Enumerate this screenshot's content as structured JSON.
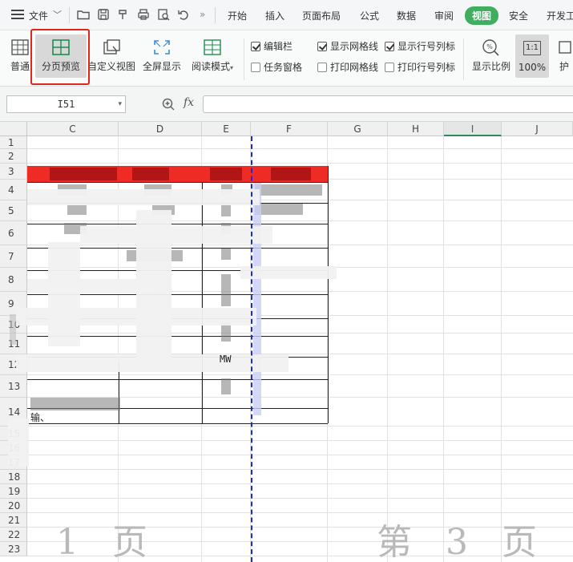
{
  "menubar": {
    "file_label": "文件",
    "tabs": [
      {
        "label": "开始"
      },
      {
        "label": "插入"
      },
      {
        "label": "页面布局"
      },
      {
        "label": "公式"
      },
      {
        "label": "数据"
      },
      {
        "label": "审阅"
      },
      {
        "label": "视图"
      },
      {
        "label": "安全"
      },
      {
        "label": "开发工"
      }
    ],
    "active_tab": "视图",
    "more": "»"
  },
  "ribbon": {
    "buttons": {
      "normal": "普通",
      "page_break_preview": "分页预览",
      "custom_view": "自定义视图",
      "fullscreen": "全屏显示",
      "reading_mode": "阅读模式",
      "zoom": "显示比例",
      "zoom_100": "100%",
      "zoom_100_icon": "1:1",
      "protect": "护"
    },
    "checkboxes": {
      "formula_bar": {
        "label": "编辑栏",
        "checked": true
      },
      "task_pane": {
        "label": "任务窗格",
        "checked": false
      },
      "show_gridlines": {
        "label": "显示网格线",
        "checked": true
      },
      "print_gridlines": {
        "label": "打印网格线",
        "checked": false
      },
      "show_headers": {
        "label": "显示行号列标",
        "checked": true
      },
      "print_headers": {
        "label": "打印行号列标",
        "checked": false
      }
    }
  },
  "formula": {
    "cell_ref": "I51",
    "fx": "fx",
    "value": ""
  },
  "sheet": {
    "columns": [
      "C",
      "D",
      "E",
      "F",
      "G",
      "H",
      "I",
      "J"
    ],
    "selected_column": "I",
    "rows": [
      "1",
      "2",
      "3",
      "4",
      "5",
      "6",
      "7",
      "8",
      "9",
      "10",
      "11",
      "12",
      "13",
      "14",
      "15",
      "16",
      "17",
      "18",
      "19",
      "20",
      "21",
      "22",
      "23"
    ],
    "cell_mw": "MW",
    "cell_row14": "输、",
    "page_label_1": "1 页",
    "page_label_3": "第 3 页"
  },
  "colors": {
    "accent_green": "#3fae5f",
    "highlight_red": "#e0261b",
    "page_break_blue": "#1f2bd1",
    "header_fill_red": "#ef2b26"
  }
}
